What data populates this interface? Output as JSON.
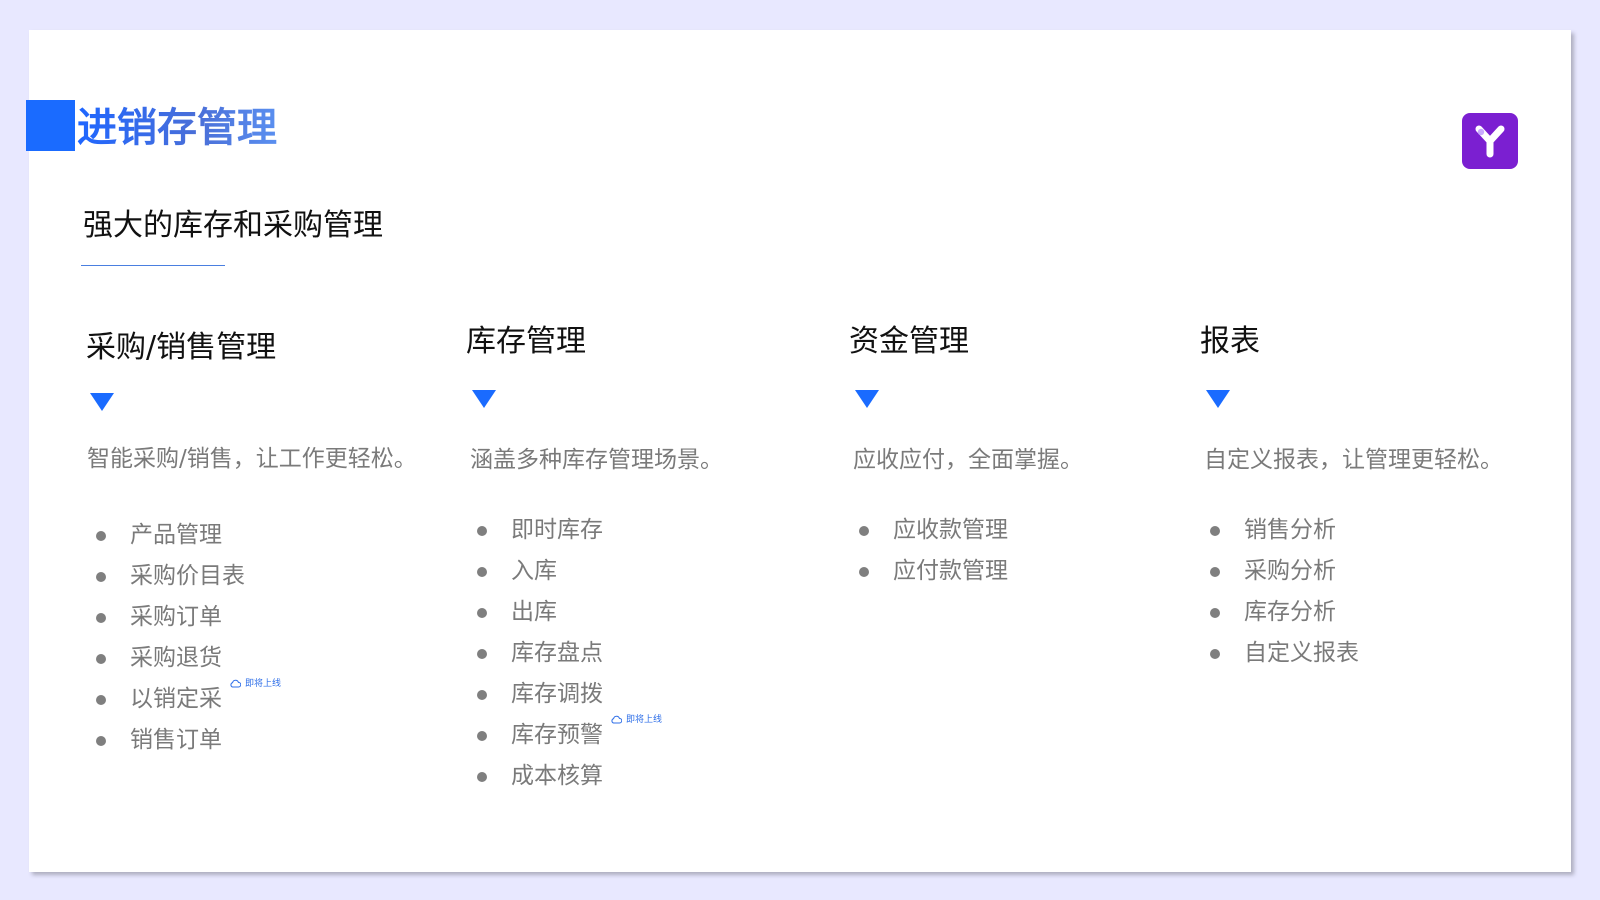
{
  "header": {
    "title": "进销存管理",
    "subtitle": "强大的库存和采购管理",
    "logo_icon": "y-logo-icon",
    "accent_color": "#1a6bff",
    "logo_color": "#7b1fd1"
  },
  "columns": [
    {
      "title": "采购/销售管理",
      "description": "智能采购/销售，让工作更轻松。",
      "items": [
        {
          "label": "产品管理",
          "badge": ""
        },
        {
          "label": "采购价目表",
          "badge": ""
        },
        {
          "label": "采购订单",
          "badge": ""
        },
        {
          "label": "采购退货",
          "badge": ""
        },
        {
          "label": "以销定采",
          "badge": "即将上线"
        },
        {
          "label": "销售订单",
          "badge": ""
        }
      ]
    },
    {
      "title": "库存管理",
      "description": "涵盖多种库存管理场景。",
      "items": [
        {
          "label": "即时库存",
          "badge": ""
        },
        {
          "label": "入库",
          "badge": ""
        },
        {
          "label": "出库",
          "badge": ""
        },
        {
          "label": "库存盘点",
          "badge": ""
        },
        {
          "label": "库存调拨",
          "badge": ""
        },
        {
          "label": "库存预警",
          "badge": "即将上线"
        },
        {
          "label": "成本核算",
          "badge": ""
        }
      ]
    },
    {
      "title": "资金管理",
      "description": "应收应付，全面掌握。",
      "items": [
        {
          "label": "应收款管理",
          "badge": ""
        },
        {
          "label": "应付款管理",
          "badge": ""
        }
      ]
    },
    {
      "title": "报表",
      "description": "自定义报表，让管理更轻松。",
      "items": [
        {
          "label": "销售分析",
          "badge": ""
        },
        {
          "label": "采购分析",
          "badge": ""
        },
        {
          "label": "库存分析",
          "badge": ""
        },
        {
          "label": "自定义报表",
          "badge": ""
        }
      ]
    }
  ]
}
